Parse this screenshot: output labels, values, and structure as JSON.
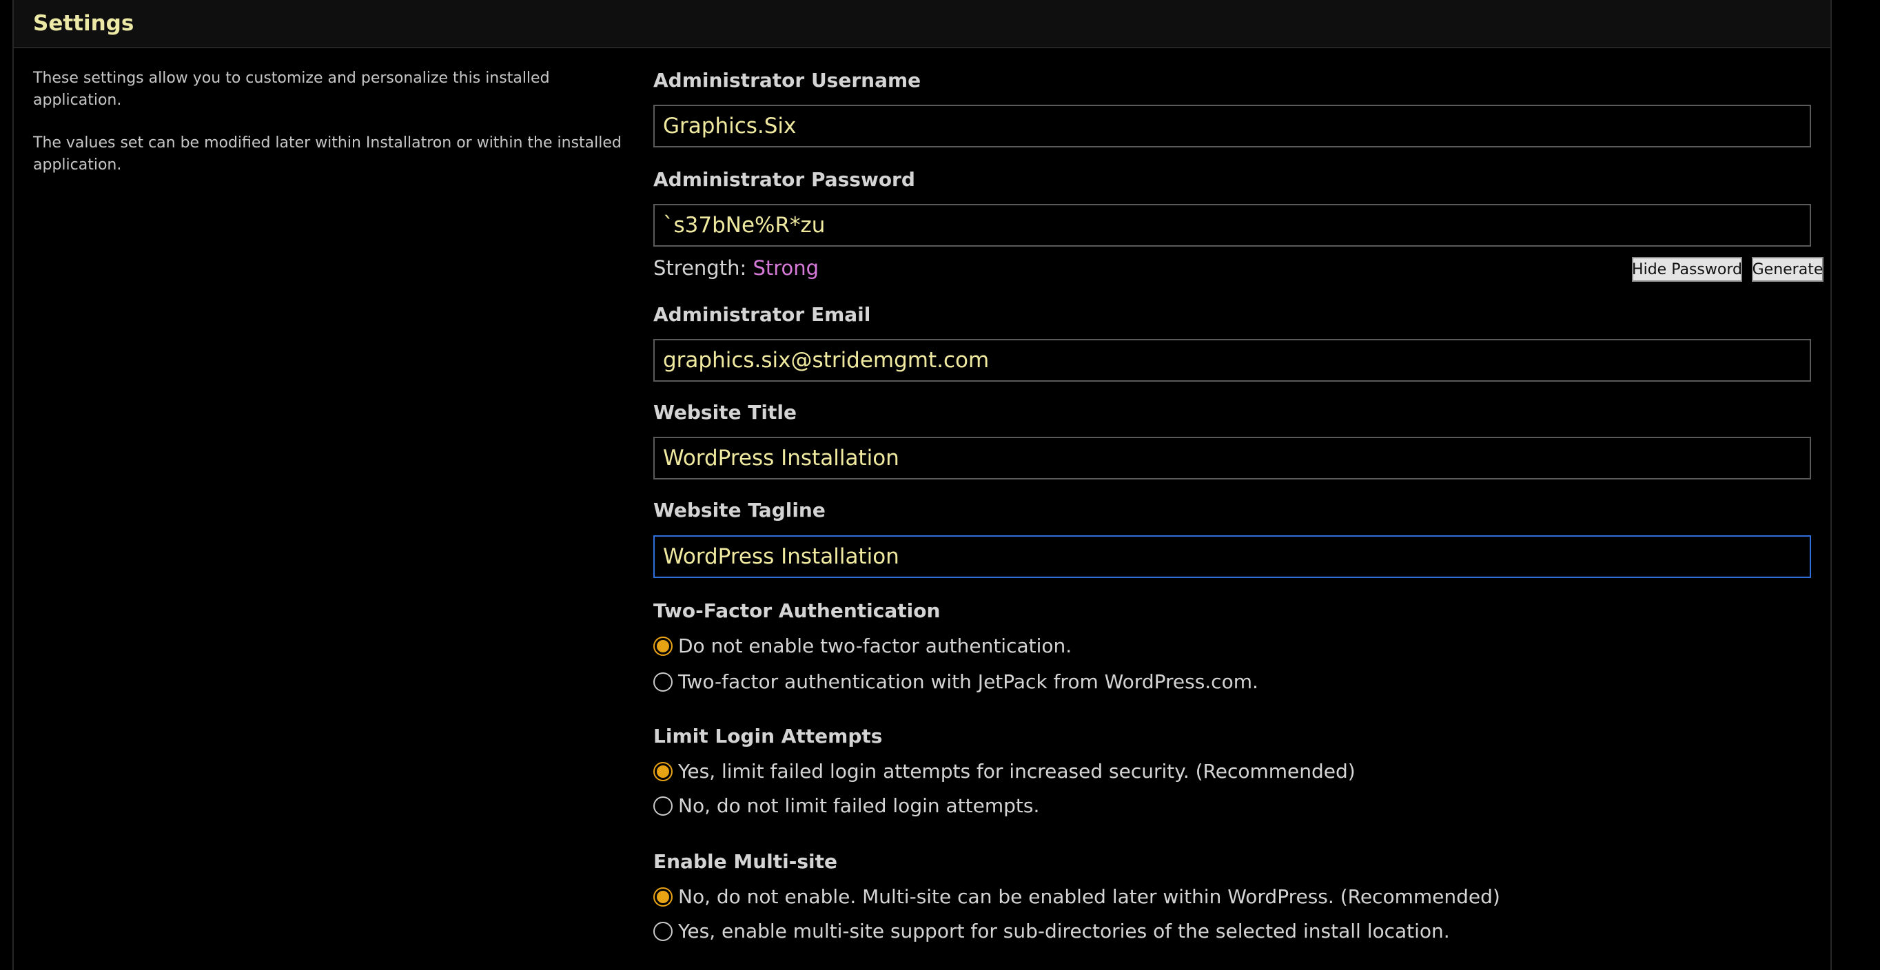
{
  "panel": {
    "title": "Settings"
  },
  "description": {
    "line1": "These settings allow you to customize and personalize this installed application.",
    "line2": "The values set can be modified later within Installatron or within the installed application."
  },
  "username": {
    "label": "Administrator Username",
    "value": "Graphics.Six"
  },
  "password": {
    "label": "Administrator Password",
    "value": "`s37bNe%R*zu",
    "strength_label": "Strength:",
    "strength_value": "Strong",
    "hide_label": "Hide Password",
    "generate_label": "Generate"
  },
  "email": {
    "label": "Administrator Email",
    "value": "graphics.six@stridemgmt.com"
  },
  "site_title": {
    "label": "Website Title",
    "value": "WordPress Installation"
  },
  "tagline": {
    "label": "Website Tagline",
    "value": "WordPress Installation"
  },
  "two_factor": {
    "label": "Two-Factor Authentication",
    "options": [
      {
        "label": "Do not enable two-factor authentication.",
        "selected": true
      },
      {
        "label": "Two-factor authentication with JetPack from WordPress.com.",
        "selected": false
      }
    ]
  },
  "limit_login": {
    "label": "Limit Login Attempts",
    "options": [
      {
        "label": "Yes, limit failed login attempts for increased security. (Recommended)",
        "selected": true
      },
      {
        "label": "No, do not limit failed login attempts.",
        "selected": false
      }
    ]
  },
  "multisite": {
    "label": "Enable Multi-site",
    "options": [
      {
        "label": "No, do not enable. Multi-site can be enabled later within WordPress. (Recommended)",
        "selected": true
      },
      {
        "label": "Yes, enable multi-site support for sub-directories of the selected install location.",
        "selected": false
      }
    ]
  },
  "colors": {
    "value_text": "#f0eaa0",
    "title_text": "#ece8a6",
    "radio_selected": "#e8a315",
    "strength_strong": "#d77ad9",
    "focus_border": "#2f6fdc"
  }
}
